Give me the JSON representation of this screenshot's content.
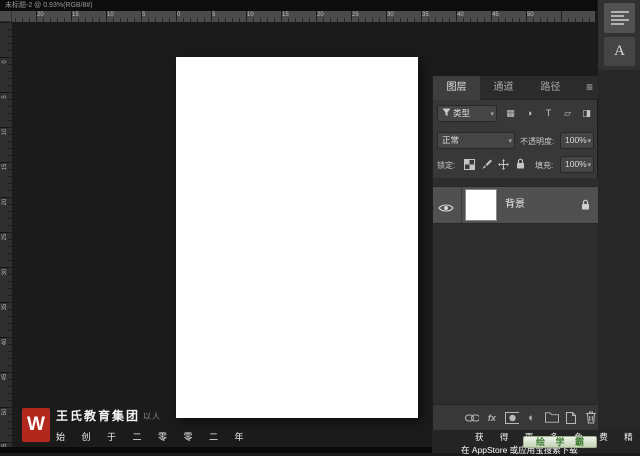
{
  "window": {
    "title": "未标题-2 @ 0.93%(RGB/8#)"
  },
  "rulers": {
    "horizontal": [
      "20",
      "15",
      "10",
      "5",
      "0",
      "5",
      "10",
      "15",
      "20",
      "25",
      "30",
      "35",
      "40",
      "45",
      "50"
    ],
    "vertical": [
      "0",
      "5",
      "10",
      "15",
      "20",
      "25",
      "30",
      "35",
      "40",
      "45",
      "50",
      "55"
    ]
  },
  "layers_panel": {
    "tabs": [
      {
        "label": "图层"
      },
      {
        "label": "通道"
      },
      {
        "label": "路径"
      }
    ],
    "panel_menu_icon": "≡",
    "filter": {
      "kind_label": "类型",
      "icons": [
        {
          "name": "pixel-layers",
          "glyph": "▦"
        },
        {
          "name": "adjustment-layers",
          "glyph": "◑"
        },
        {
          "name": "type-layers",
          "glyph": "T"
        },
        {
          "name": "shape-layers",
          "glyph": "▱"
        },
        {
          "name": "smart-objects",
          "glyph": "◨"
        }
      ]
    },
    "blend_mode": "正常",
    "opacity": {
      "label": "不透明度:",
      "value": "100%"
    },
    "lock": {
      "label": "锁定:"
    },
    "fill": {
      "label": "填充:",
      "value": "100%"
    },
    "layers": [
      {
        "name": "背景",
        "visible": true,
        "locked": true
      }
    ],
    "fx_label": "fx",
    "adjustment_glyph": "◐",
    "bottom_icons": [
      "link",
      "fx",
      "layer-mask",
      "adjustment",
      "group",
      "new-layer",
      "delete"
    ]
  },
  "right_dock": {
    "character_panel_letter": "A"
  },
  "watermark_promo": {
    "line1": "获 得 更 多 免 费 精 品 教 程",
    "app_badge": "绘 学 霸",
    "line2": "在 AppStore 或应用宝搜索下载"
  },
  "watermark_brand": {
    "logo_letter": "W",
    "company": "王氏教育集团",
    "tagline": "以人",
    "founded": "始 创 于 二 零 零 二 年"
  },
  "colors": {
    "logo_red": "#b3281c",
    "badge_bg": "#dfe8d4",
    "badge_text": "#3f7d33",
    "panel_bg": "#383838",
    "canvas_white": "#ffffff"
  }
}
